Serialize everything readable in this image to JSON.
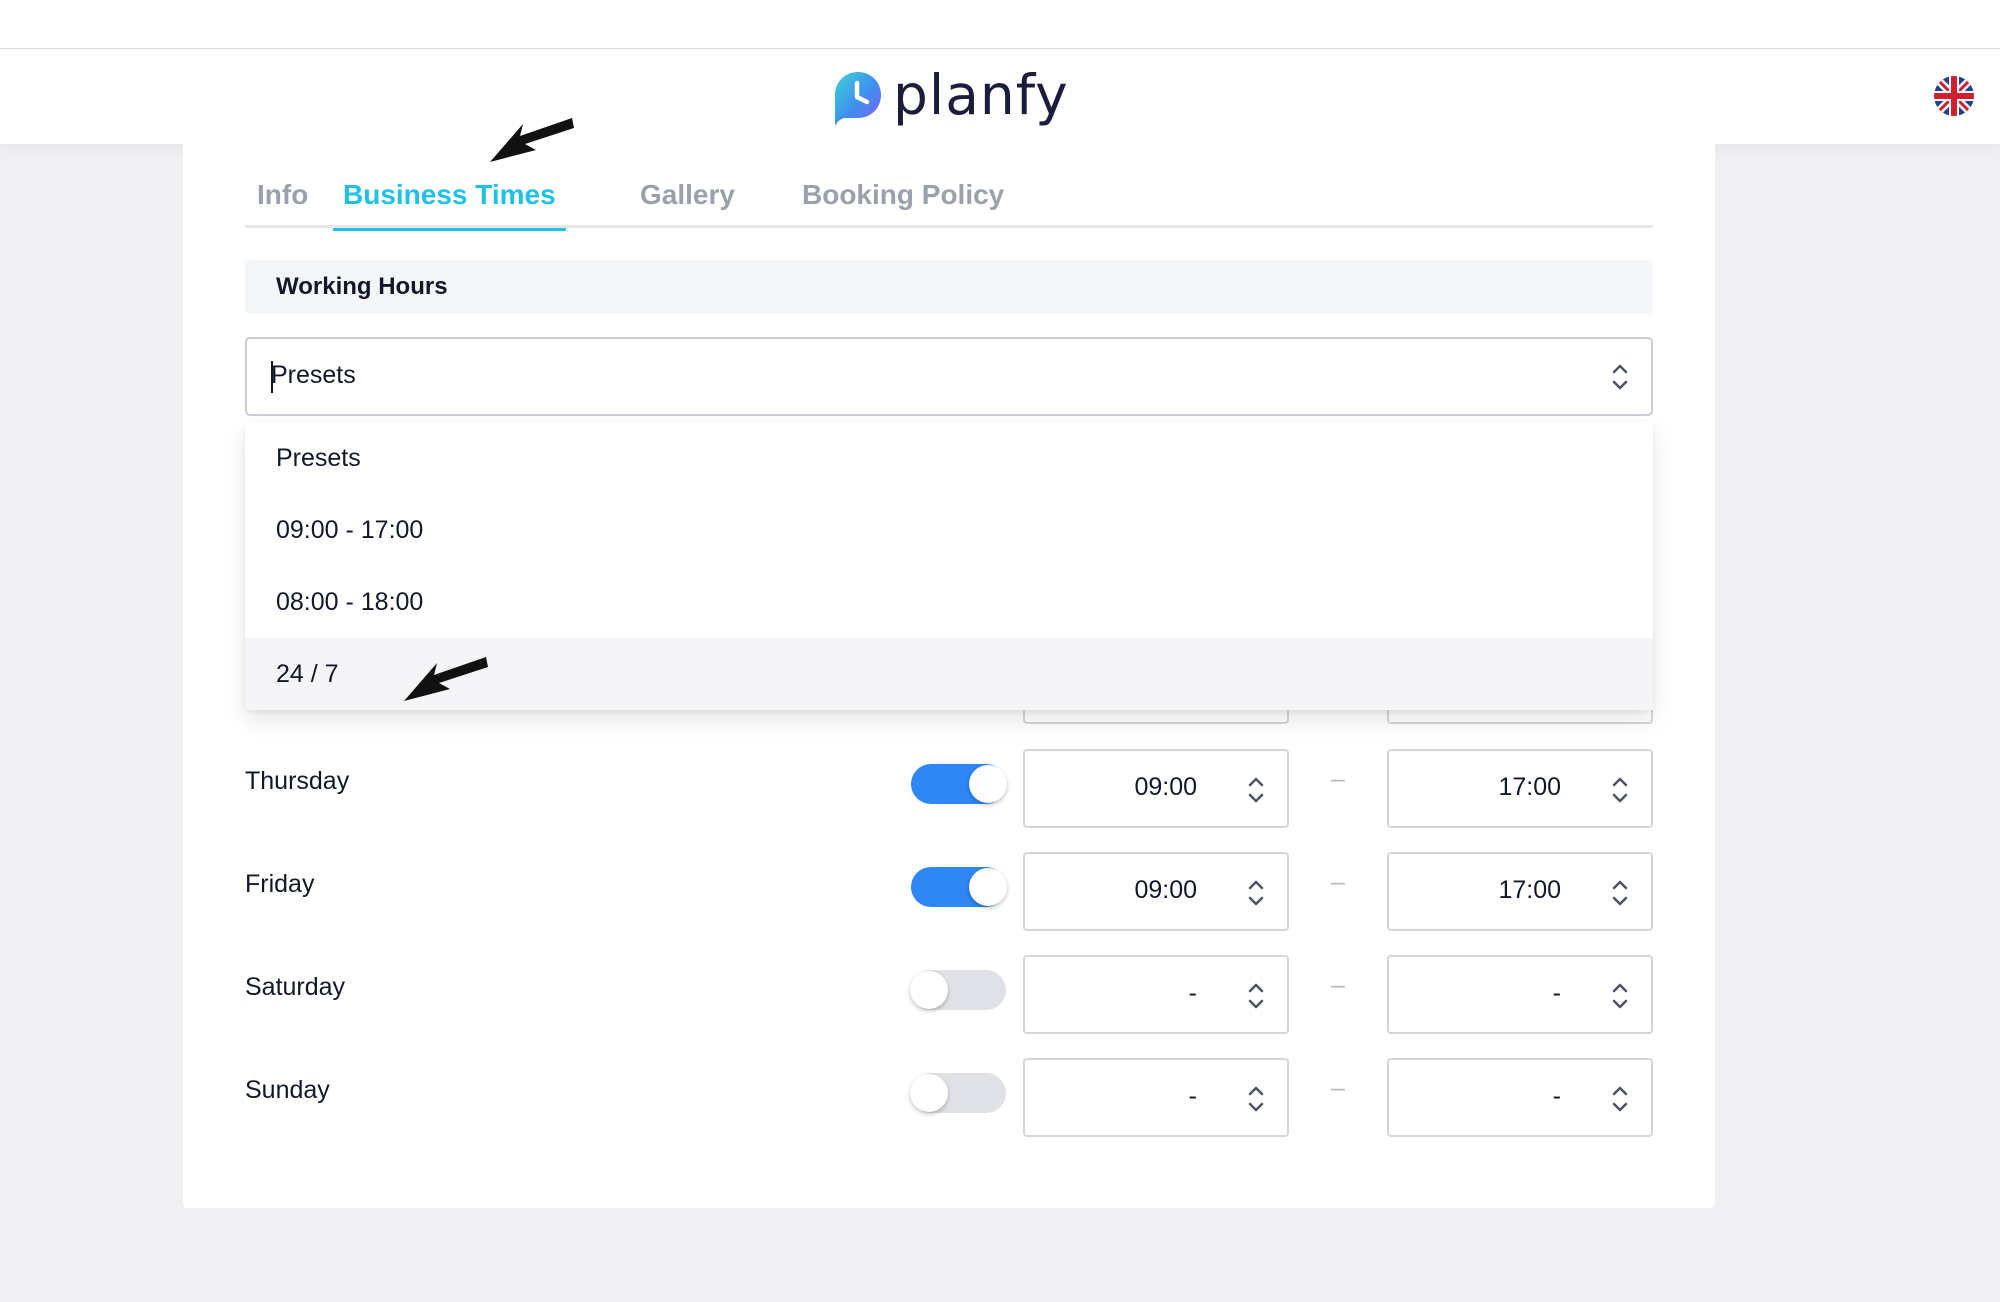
{
  "header": {
    "logo_text": "planfy",
    "language_icon": "uk-flag-icon"
  },
  "tabs": [
    {
      "label": "Info",
      "active": false
    },
    {
      "label": "Business Times",
      "active": true
    },
    {
      "label": "Gallery",
      "active": false
    },
    {
      "label": "Booking Policy",
      "active": false
    }
  ],
  "section": {
    "title": "Working Hours"
  },
  "presets": {
    "value": "Presets",
    "options": [
      "Presets",
      "09:00 - 17:00",
      "08:00 - 18:00",
      "24 / 7"
    ],
    "highlighted": "24 / 7"
  },
  "days": [
    {
      "label": "Thursday",
      "enabled": true,
      "start": "09:00",
      "end": "17:00"
    },
    {
      "label": "Friday",
      "enabled": true,
      "start": "09:00",
      "end": "17:00"
    },
    {
      "label": "Saturday",
      "enabled": false,
      "start": "-",
      "end": "-"
    },
    {
      "label": "Sunday",
      "enabled": false,
      "start": "-",
      "end": "-"
    }
  ],
  "separator": "–",
  "colors": {
    "accent": "#1fc1e4",
    "toggle_on": "#2f86f5",
    "toggle_off": "#e0e1e6",
    "text": "#111827",
    "tab_inactive": "#9aa1ab"
  }
}
